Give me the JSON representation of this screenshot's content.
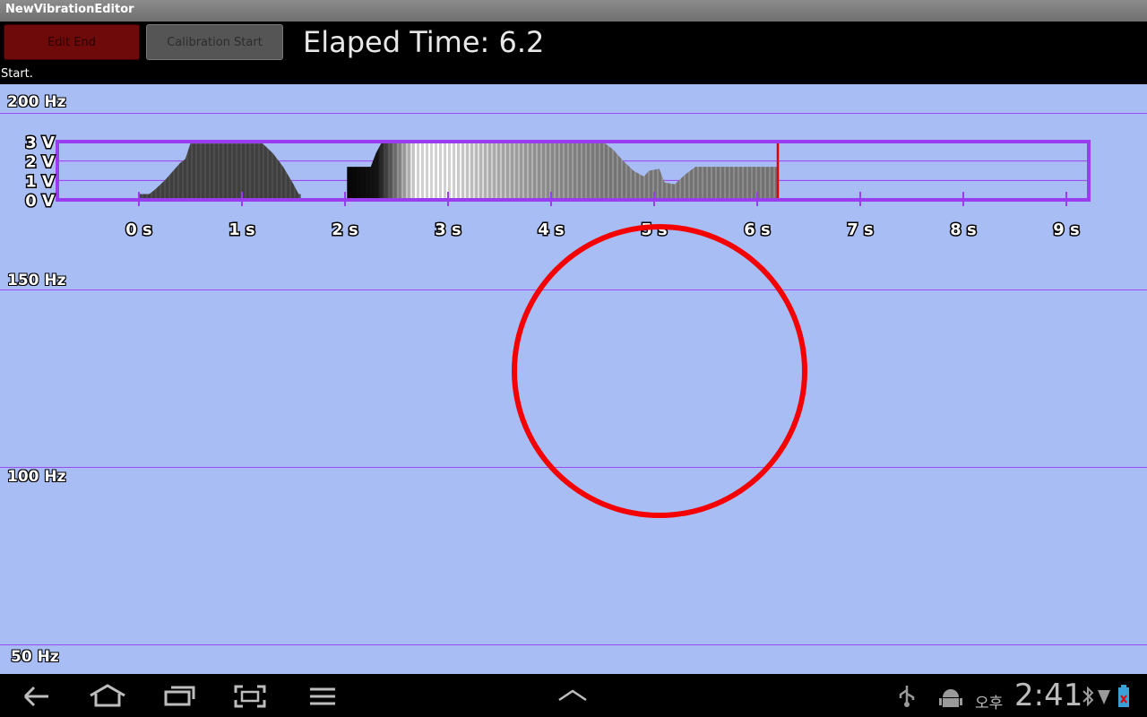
{
  "window": {
    "title": "NewVibrationEditor"
  },
  "toolbar": {
    "edit_end_label": "Edit End",
    "calibration_start_label": "Calibration Start",
    "elapsed_label": "Elaped Time: 6.2"
  },
  "status": {
    "text": "Start."
  },
  "frequency_labels": [
    "200 Hz",
    "150 Hz",
    "100 Hz",
    "50 Hz"
  ],
  "colors": {
    "accent": "#9a3cf0",
    "cursor": "#e00000",
    "circle": "#f40000",
    "background": "#a9bdf5"
  },
  "chart_data": {
    "type": "area",
    "xlabel": "",
    "ylabel": "",
    "x_ticks": [
      "0 s",
      "1 s",
      "2 s",
      "3 s",
      "4 s",
      "5 s",
      "6 s",
      "7 s",
      "8 s",
      "9 s"
    ],
    "y_ticks": [
      "0 V",
      "1 V",
      "2 V",
      "3 V"
    ],
    "xlim": [
      -0.8,
      9.2
    ],
    "ylim": [
      0,
      3
    ],
    "cursor_time": 6.2,
    "segments": [
      {
        "shade": "dark-gray",
        "points": [
          [
            0.0,
            0.3
          ],
          [
            0.1,
            0.3
          ],
          [
            0.15,
            0.5
          ],
          [
            0.25,
            1.0
          ],
          [
            0.35,
            1.6
          ],
          [
            0.4,
            1.9
          ],
          [
            0.45,
            2.1
          ],
          [
            0.5,
            2.9
          ],
          [
            0.6,
            2.9
          ],
          [
            1.2,
            2.9
          ],
          [
            1.3,
            2.4
          ],
          [
            1.4,
            1.7
          ],
          [
            1.5,
            0.8
          ],
          [
            1.55,
            0.3
          ],
          [
            1.57,
            0.3
          ]
        ]
      },
      {
        "shade": "black-to-white-to-gray",
        "points": [
          [
            2.02,
            1.7
          ],
          [
            2.25,
            1.7
          ],
          [
            2.3,
            2.4
          ],
          [
            2.35,
            2.9
          ],
          [
            2.5,
            3.0
          ],
          [
            3.0,
            3.0
          ],
          [
            4.5,
            3.0
          ],
          [
            4.6,
            2.6
          ],
          [
            4.7,
            2.0
          ],
          [
            4.8,
            1.5
          ],
          [
            4.9,
            1.2
          ],
          [
            4.95,
            1.5
          ],
          [
            5.05,
            1.6
          ],
          [
            5.1,
            0.9
          ],
          [
            5.2,
            0.8
          ],
          [
            5.3,
            1.3
          ],
          [
            5.4,
            1.7
          ],
          [
            6.2,
            1.7
          ]
        ]
      }
    ]
  },
  "navigation": {
    "icons": [
      "back-icon",
      "home-icon",
      "recent-apps-icon",
      "screenshot-icon",
      "menu-icon",
      "chevron-up-icon"
    ],
    "status_icons": [
      "usb-icon",
      "android-debug-icon",
      "bluetooth-icon",
      "wifi-icon",
      "battery-icon"
    ],
    "ampm": "오후",
    "time": "2:41"
  }
}
